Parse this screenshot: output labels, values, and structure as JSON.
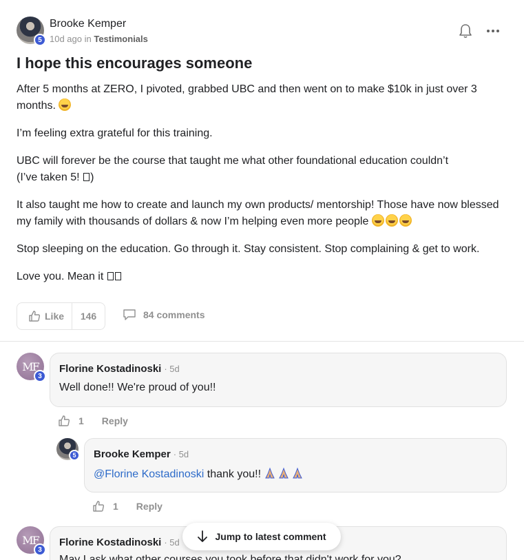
{
  "post": {
    "author": "Brooke Kemper",
    "author_level": "5",
    "time_ago": "10d ago",
    "in_word": "in",
    "category": "Testimonials",
    "title": "I hope this encourages someone",
    "paragraphs": {
      "p1": "After 5 months at ZERO, I pivoted, grabbed UBC and then went on to make $10k in just over 3 months.",
      "p2": "I’m feeling extra grateful for this training.",
      "p3a": "UBC will forever be the course that taught me what other foundational education couldn’t",
      "p3b": "(I’ve taken 5!",
      "p3c": ")",
      "p4": "It also taught me how to create and launch my own products/ mentorship! Those have now blessed my family with thousands of dollars & now I’m helping even more people",
      "p5": "Stop sleeping on the education. Go through it. Stay consistent. Stop complaining & get to work.",
      "p6": "Love you. Mean it"
    },
    "like_label": "Like",
    "like_count": "146",
    "comments_label": "84 comments"
  },
  "comments": {
    "c1": {
      "avatar_initials": "MF",
      "level": "3",
      "name": "Florine Kostadinoski",
      "time": "· 5d",
      "text": "Well done!! We're proud of you!!",
      "likes": "1",
      "reply_label": "Reply"
    },
    "c2": {
      "level": "5",
      "name": "Brooke Kemper",
      "time": "· 5d",
      "mention": "@Florine Kostadinoski",
      "text": " thank you!!",
      "likes": "1",
      "reply_label": "Reply"
    },
    "c3": {
      "avatar_initials": "MF",
      "level": "3",
      "name": "Florine Kostadinoski",
      "time": "· 5d",
      "text": "May I ask what other courses you took before that didn't work for you?"
    }
  },
  "jump_button": {
    "label": "Jump to latest comment"
  },
  "colors": {
    "level_badge": "#3d5bd4",
    "mention": "#2d6bc9",
    "muted": "#909090"
  }
}
